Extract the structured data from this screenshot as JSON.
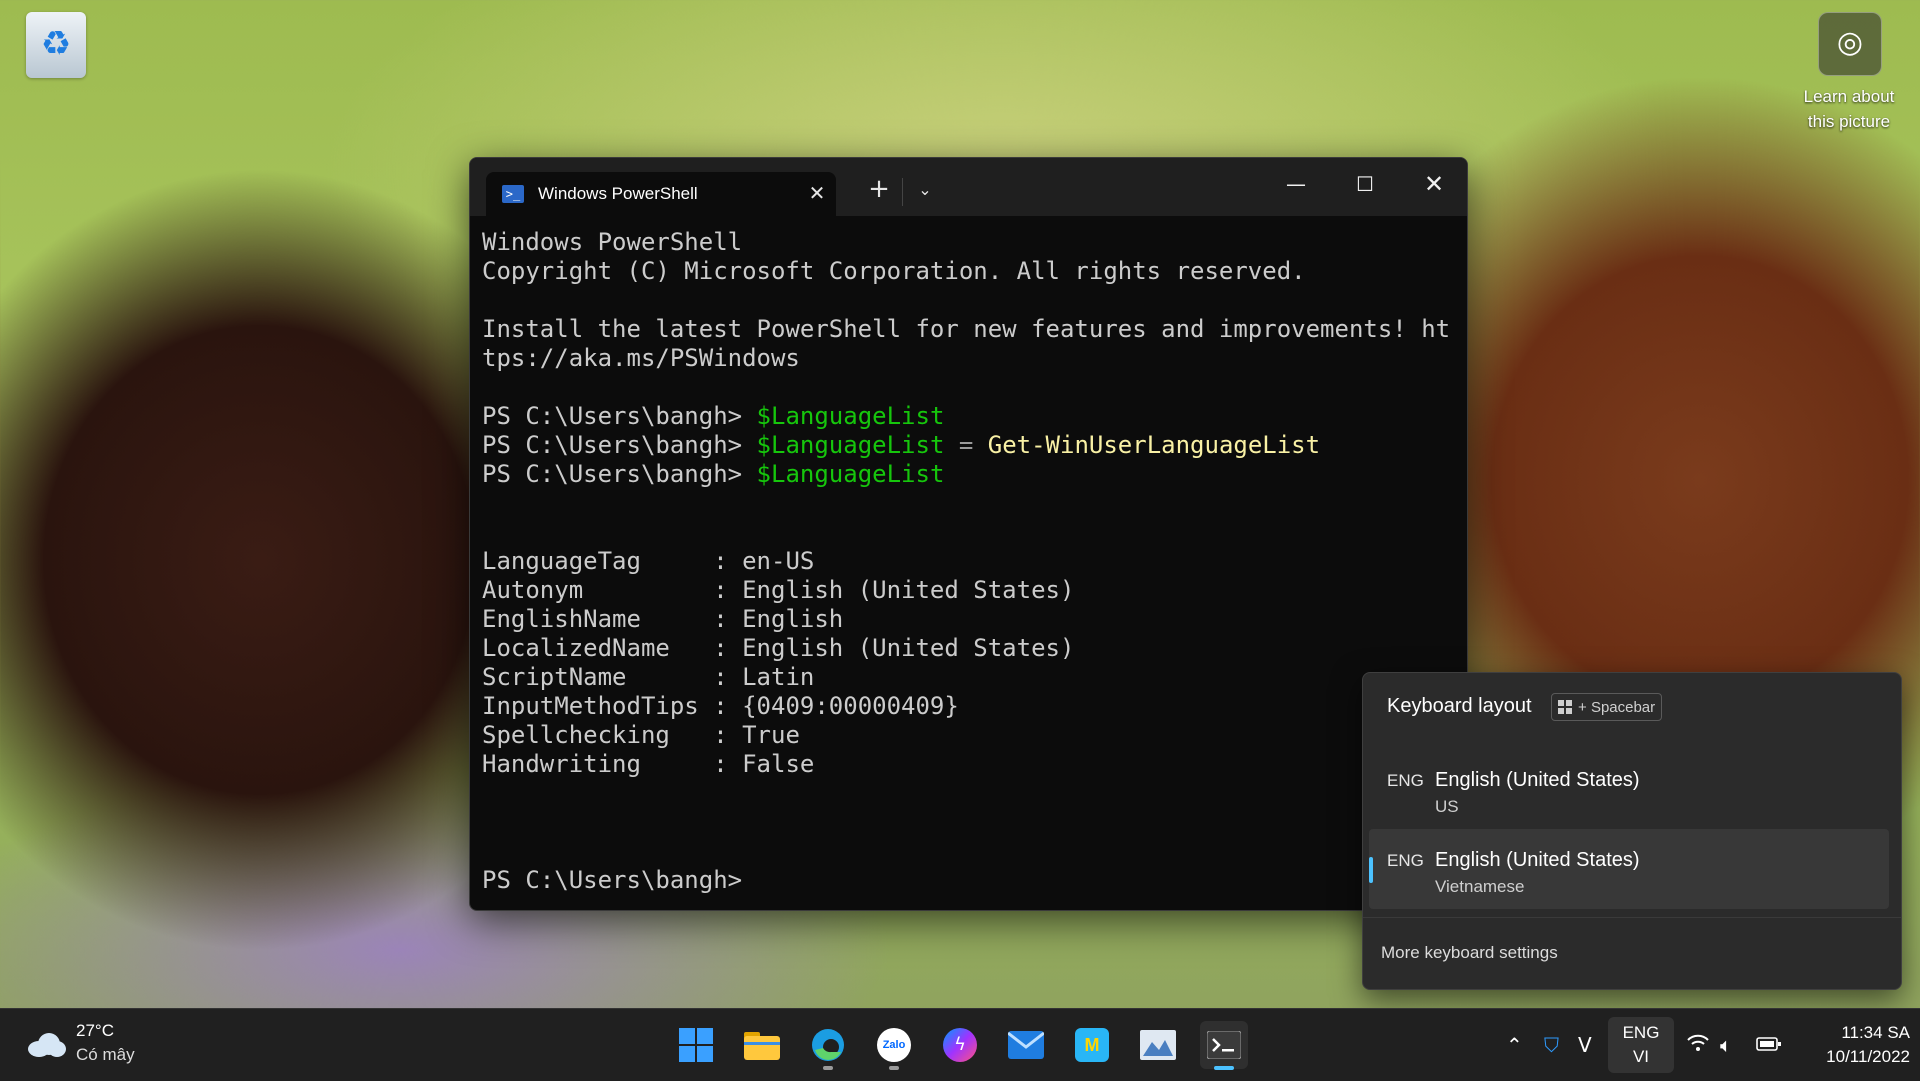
{
  "desktop": {
    "learn_label_line1": "Learn about",
    "learn_label_line2": "this picture"
  },
  "terminal": {
    "tab_title": "Windows PowerShell",
    "lines": {
      "l1": "Windows PowerShell",
      "l2": "Copyright (C) Microsoft Corporation. All rights reserved.",
      "l3": "Install the latest PowerShell for new features and improvements! ht",
      "l4": "tps://aka.ms/PSWindows",
      "prompt": "PS C:\\Users\\bangh> ",
      "var": "$LanguageList",
      "eq": " = ",
      "cmdlet": "Get-WinUserLanguageList"
    },
    "properties": [
      {
        "key": "LanguageTag     ",
        "value": "en-US"
      },
      {
        "key": "Autonym         ",
        "value": "English (United States)"
      },
      {
        "key": "EnglishName     ",
        "value": "English"
      },
      {
        "key": "LocalizedName   ",
        "value": "English (United States)"
      },
      {
        "key": "ScriptName      ",
        "value": "Latin"
      },
      {
        "key": "InputMethodTips ",
        "value": "{0409:00000409}"
      },
      {
        "key": "Spellchecking   ",
        "value": "True"
      },
      {
        "key": "Handwriting     ",
        "value": "False"
      }
    ],
    "separator": ": ",
    "final_prompt": "PS C:\\Users\\bangh>"
  },
  "flyout": {
    "title": "Keyboard layout",
    "shortcut_plus": "+",
    "shortcut_key": "Spacebar",
    "options": [
      {
        "code": "ENG",
        "name": "English (United States)",
        "sub": "US",
        "selected": false
      },
      {
        "code": "ENG",
        "name": "English (United States)",
        "sub": "Vietnamese",
        "selected": true
      }
    ],
    "more": "More keyboard settings"
  },
  "taskbar": {
    "temp": "27°C",
    "condition": "Có mây",
    "lang_top": "ENG",
    "lang_bottom": "VI",
    "time": "11:34 SA",
    "date": "10/11/2022",
    "zalo_label": "Zalo",
    "mail_label": "M"
  }
}
